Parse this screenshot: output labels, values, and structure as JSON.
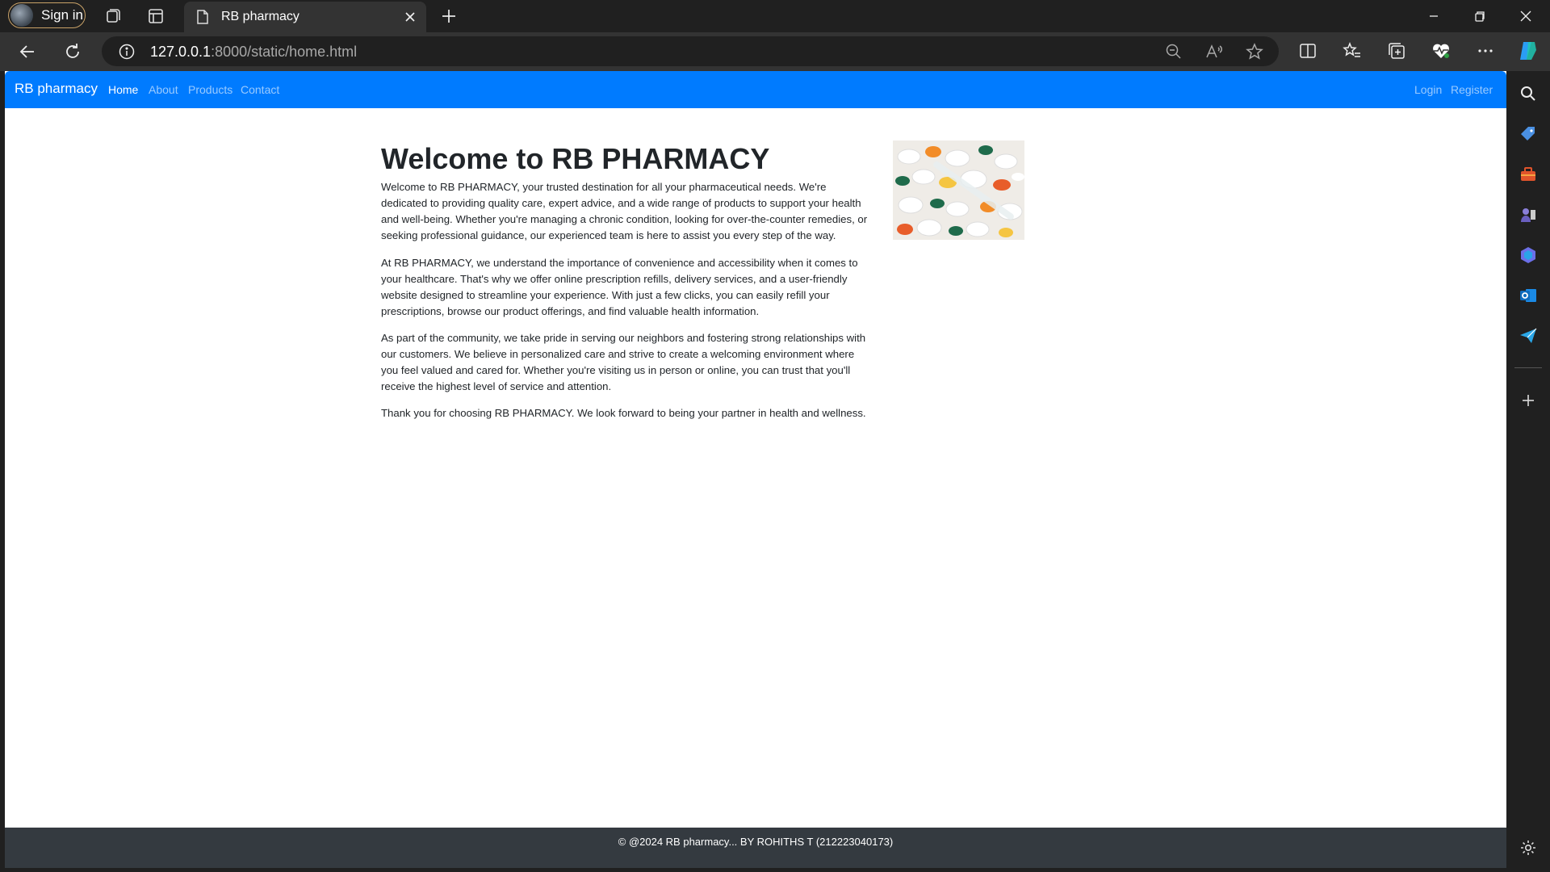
{
  "browser": {
    "signin_label": "Sign in",
    "tab_title": "RB pharmacy",
    "url_host": "127.0.0.1",
    "url_path": ":8000/static/home.html",
    "icons": {
      "workspaces": "workspaces-icon",
      "tab_actions": "tab-actions-icon",
      "page": "page-icon",
      "close": "close-icon",
      "new_tab": "plus-icon",
      "minimize": "minimize-icon",
      "restore": "restore-icon",
      "window_close": "window-close-icon",
      "back": "back-arrow-icon",
      "refresh": "refresh-icon",
      "info": "info-icon",
      "zoom": "zoom-out-icon",
      "read_aloud": "read-aloud-icon",
      "favorite": "star-icon",
      "split_screen": "split-screen-icon",
      "favorites": "favorites-icon",
      "collections": "collections-icon",
      "health": "browser-essentials-icon",
      "more": "more-icon",
      "copilot": "copilot-icon"
    },
    "sidebar_icons": [
      "search-icon",
      "shopping-tag-icon",
      "tools-icon",
      "games-icon",
      "microsoft-365-icon",
      "outlook-icon",
      "send-icon",
      "add-icon",
      "settings-icon"
    ]
  },
  "site": {
    "brand": "RB pharmacy",
    "nav": [
      {
        "label": "Home",
        "active": true
      },
      {
        "label": "About",
        "active": false
      },
      {
        "label": "Products",
        "active": false
      },
      {
        "label": "Contact",
        "active": false
      }
    ],
    "auth": {
      "login": "Login",
      "register": "Register"
    },
    "colors": {
      "navbar": "#007bff",
      "footer": "#343a40",
      "text": "#212529"
    }
  },
  "main": {
    "title": "Welcome to RB PHARMACY",
    "paragraphs": [
      "Welcome to RB PHARMACY, your trusted destination for all your pharmaceutical needs. We're dedicated to providing quality care, expert advice, and a wide range of products to support your health and well-being. Whether you're managing a chronic condition, looking for over-the-counter remedies, or seeking professional guidance, our experienced team is here to assist you every step of the way.",
      "At RB PHARMACY, we understand the importance of convenience and accessibility when it comes to your healthcare. That's why we offer online prescription refills, delivery services, and a user-friendly website designed to streamline your experience. With just a few clicks, you can easily refill your prescriptions, browse our product offerings, and find valuable health information.",
      "As part of the community, we take pride in serving our neighbors and fostering strong relationships with our customers. We believe in personalized care and strive to create a welcoming environment where you feel valued and cared for. Whether you're visiting us in person or online, you can trust that you'll receive the highest level of service and attention.",
      "Thank you for choosing RB PHARMACY. We look forward to being your partner in health and wellness."
    ]
  },
  "footer": {
    "text": "© @2024 RB pharmacy... BY ROHITHS T (212223040173)"
  }
}
